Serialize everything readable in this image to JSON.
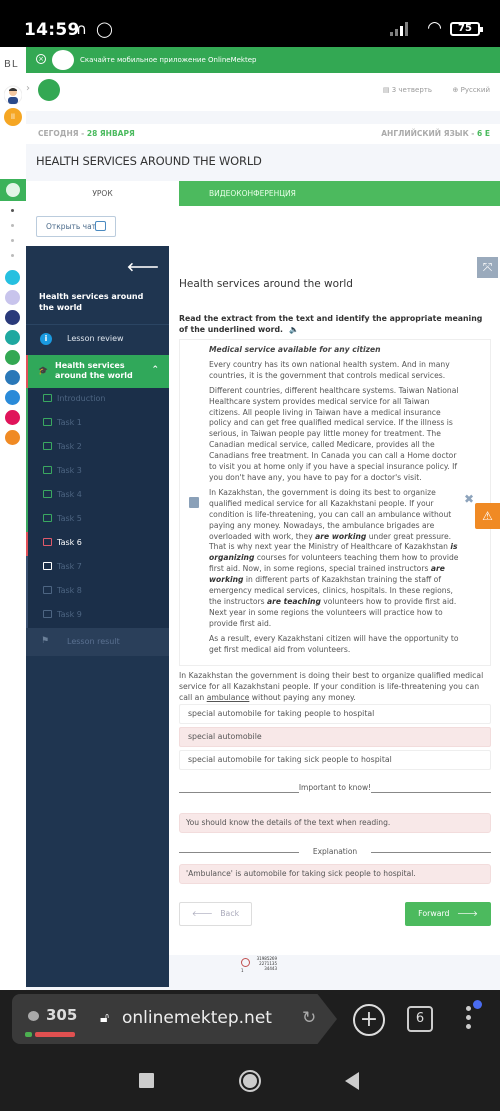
{
  "status_bar": {
    "time": "14:59",
    "battery": "75"
  },
  "banner": {
    "text": "Скачайте мобильное приложение OnlineMektep"
  },
  "header": {
    "quarter": "3 четверть",
    "language": "Русский"
  },
  "date_bar": {
    "today_label": "СЕГОДНЯ - ",
    "today_date": "28 ЯНВАРЯ",
    "subject_label": "АНГЛИЙСКИЙ ЯЗЫК - ",
    "subject_grade": "6 Е"
  },
  "lesson_title": "HEALTH SERVICES AROUND THE WORLD",
  "tabs": [
    {
      "label": "УРОК",
      "active": true
    },
    {
      "label": "ВИДЕОКОНФЕРЕНЦИЯ",
      "active": false
    }
  ],
  "chat_button": "Открыть чат",
  "sidebar": {
    "title": "Health services around the world",
    "review": "Lesson review",
    "section": "Health services around the world",
    "items": [
      {
        "label": "Introduction",
        "state": "done"
      },
      {
        "label": "Task 1",
        "state": "done"
      },
      {
        "label": "Task 2",
        "state": "done"
      },
      {
        "label": "Task 3",
        "state": "done"
      },
      {
        "label": "Task 4",
        "state": "done"
      },
      {
        "label": "Task 5",
        "state": "done"
      },
      {
        "label": "Task 6",
        "state": "current"
      },
      {
        "label": "Task 7",
        "state": "next"
      },
      {
        "label": "Task 8",
        "state": "future"
      },
      {
        "label": "Task 9",
        "state": "future"
      }
    ],
    "result": "Lesson result"
  },
  "task": {
    "title": "Health services around the world",
    "instruction": "Read the extract from the text and identify the appropriate meaning of the underlined word.",
    "passage_title": "Medical service available for any citizen",
    "p1": "Every country has its own national health system. And in many countries, it is the government that controls medical services.",
    "p2": "Different countries, different healthcare systems. Taiwan National Healthcare system provides medical service for all Taiwan citizens. All people living in Taiwan have a medical insurance policy and can get free qualified medical service. If the illness is serious, in Taiwan people pay little money for treatment. The Canadian medical service, called Medicare, provides all the Canadians free treatment. In Canada you can call a Home doctor to visit you at home only if you have a special insurance policy. If you don't have any, you have to pay for a doctor's visit.",
    "p3": {
      "a": "In Kazakhstan, the government is doing its best to organize qualified medical service for all Kazakhstani people. If your condition is life-threatening, you can call an ambulance without paying any money. Nowadays, the ambulance brigades are overloaded with work, they ",
      "b1": "are working",
      "c": " under great pressure. That is why next year the Ministry of Healthcare of Kazakhstan ",
      "b2": "is organizing",
      "d": " courses for volunteers teaching them how to provide first aid. Now, in some regions, special trained instructors ",
      "b3": "are working",
      "e": " in different parts of Kazakhstan training the staff of emergency medical services, clinics, hospitals. In these regions, the instructors ",
      "b4": "are teaching",
      "f": " volunteers how to provide first aid. Next year in some regions the volunteers will practice how to provide first aid."
    },
    "p4": "As a result, every Kazakhstani citizen will have the opportunity to get first medical aid from volunteers.",
    "question_before": "In Kazakhstan the government is doing their best to organize qualified medical service for all Kazakhstani people. If your condition is life-threatening you can call an ",
    "question_word": "ambulance",
    "question_after": " without paying any money.",
    "options": [
      {
        "label": "special automobile for taking people to hospital",
        "state": "normal"
      },
      {
        "label": "special automobile",
        "state": "wrong"
      },
      {
        "label": "special automobile for taking sick people to hospital",
        "state": "normal"
      }
    ],
    "important_label": "Important to know!",
    "important_text": "You should know the details of the text when reading.",
    "explanation_label": "Explanation",
    "explanation_text": "'Ambulance' is automobile for taking sick people to hospital.",
    "back_label": "Back",
    "forward_label": "Forward"
  },
  "footer_counter": {
    "left": "1",
    "lines": [
      "31985269",
      "2271135",
      "34443"
    ]
  },
  "browser": {
    "comment_count": "305",
    "url": "onlinemektep.net",
    "tab_count": "6"
  }
}
